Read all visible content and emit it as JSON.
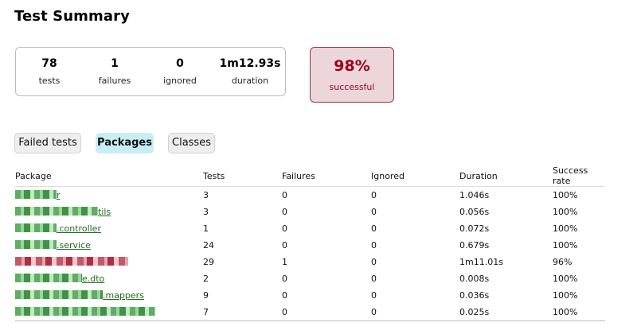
{
  "page_title": "Test Summary",
  "counters": [
    {
      "value": "78",
      "label": "tests"
    },
    {
      "value": "1",
      "label": "failures"
    },
    {
      "value": "0",
      "label": "ignored"
    },
    {
      "value": "1m12.93s",
      "label": "duration"
    }
  ],
  "success": {
    "value": "98%",
    "label": "successful"
  },
  "tabs": [
    {
      "label": "Failed tests",
      "active": false
    },
    {
      "label": "Packages",
      "active": true
    },
    {
      "label": "Classes",
      "active": false
    }
  ],
  "table": {
    "headers": [
      "Package",
      "Tests",
      "Failures",
      "Ignored",
      "Duration",
      "Success rate"
    ],
    "rows": [
      {
        "package_visible": "r",
        "tests": "3",
        "failures": "0",
        "ignored": "0",
        "duration": "1.046s",
        "rate": "100%",
        "status": "ok"
      },
      {
        "package_visible": "tils",
        "tests": "3",
        "failures": "0",
        "ignored": "0",
        "duration": "0.056s",
        "rate": "100%",
        "status": "ok"
      },
      {
        "package_visible": ".controller",
        "tests": "1",
        "failures": "0",
        "ignored": "0",
        "duration": "0.072s",
        "rate": "100%",
        "status": "ok"
      },
      {
        "package_visible": ".service",
        "tests": "24",
        "failures": "0",
        "ignored": "0",
        "duration": "0.679s",
        "rate": "100%",
        "status": "ok"
      },
      {
        "package_visible": "",
        "tests": "29",
        "failures": "1",
        "ignored": "0",
        "duration": "1m11.01s",
        "rate": "96%",
        "status": "fail"
      },
      {
        "package_visible": "e.dto",
        "tests": "2",
        "failures": "0",
        "ignored": "0",
        "duration": "0.008s",
        "rate": "100%",
        "status": "ok"
      },
      {
        "package_visible": ".mappers",
        "tests": "9",
        "failures": "0",
        "ignored": "0",
        "duration": "0.036s",
        "rate": "100%",
        "status": "ok"
      },
      {
        "package_visible": "",
        "tests": "7",
        "failures": "0",
        "ignored": "0",
        "duration": "0.025s",
        "rate": "100%",
        "status": "ok"
      }
    ]
  },
  "colors": {
    "success": "#1a7a1a",
    "failure": "#a00020",
    "active_tab": "#c8eef5",
    "failure_box": "#ecd6d9"
  }
}
